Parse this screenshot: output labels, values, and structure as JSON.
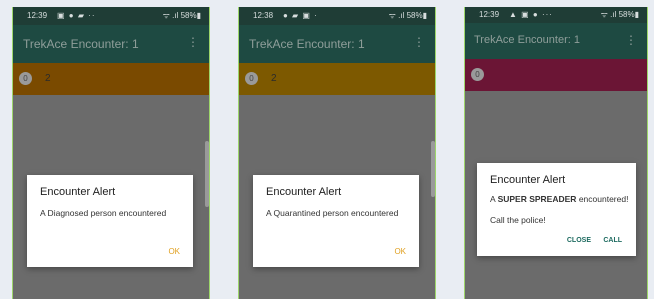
{
  "screens": [
    {
      "status": {
        "time": "12:39",
        "icons": "▣ ● ▰ ··",
        "battery": "58%▮"
      },
      "app_title": "TrekAce Encounter: 1",
      "banner_count": "2",
      "banner_icon_text": "0",
      "dialog": {
        "title": "Encounter Alert",
        "message": "A Diagnosed person encountered",
        "ok": "OK"
      }
    },
    {
      "status": {
        "time": "12:38",
        "icons": "● ▰ ▣ ·",
        "battery": "58%▮"
      },
      "app_title": "TrekAce Encounter: 1",
      "banner_count": "2",
      "banner_icon_text": "0",
      "dialog": {
        "title": "Encounter Alert",
        "message": "A Quarantined person encountered",
        "ok": "OK"
      }
    },
    {
      "status": {
        "time": "12:39",
        "icons": "▲ ▣ ● ···",
        "battery": "58%▮"
      },
      "app_title": "TrekAce Encounter: 1",
      "banner_count": "",
      "banner_icon_text": "0",
      "dialog": {
        "title": "Encounter Alert",
        "message_prefix": "A ",
        "message_bold": "SUPER SPREADER",
        "message_suffix": " encountered!",
        "message2": "Call the police!",
        "close": "CLOSE",
        "call": "CALL"
      }
    }
  ],
  "colors": {
    "appbar": "#1e4a42",
    "statusbar": "#1f3d36",
    "accent_ok": "#e0a020",
    "accent_teal": "#1e6b60"
  },
  "icons": [
    "wifi-icon",
    "signal-icon",
    "battery-icon",
    "overflow-menu-icon"
  ]
}
